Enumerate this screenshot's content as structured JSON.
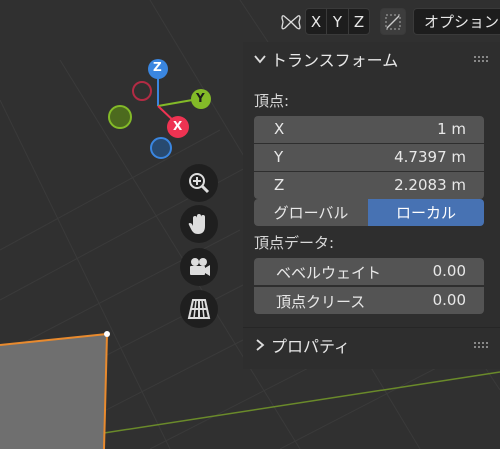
{
  "header": {
    "axis_x": "X",
    "axis_y": "Y",
    "axis_z": "Z",
    "options": "オプション"
  },
  "gizmo": {
    "z": "Z",
    "y": "Y",
    "x": "X",
    "colors": {
      "x": "#ee3352",
      "y": "#83ba28",
      "z": "#3a86e0"
    }
  },
  "transform": {
    "title": "トランスフォーム",
    "vertex_label": "頂点:",
    "x_label": "X",
    "x_value": "1 m",
    "y_label": "Y",
    "y_value": "4.7397 m",
    "z_label": "Z",
    "z_value": "2.2083 m",
    "global": "グローバル",
    "local": "ローカル",
    "vertex_data_label": "頂点データ:",
    "bevel_weight_label": "ベベルウェイト",
    "bevel_weight_value": "0.00",
    "crease_label": "頂点クリース",
    "crease_value": "0.00"
  },
  "properties": {
    "title": "プロパティ"
  },
  "colors": {
    "accent": "#4772b3",
    "field": "#545454",
    "selection_edge": "#e88a2e"
  }
}
